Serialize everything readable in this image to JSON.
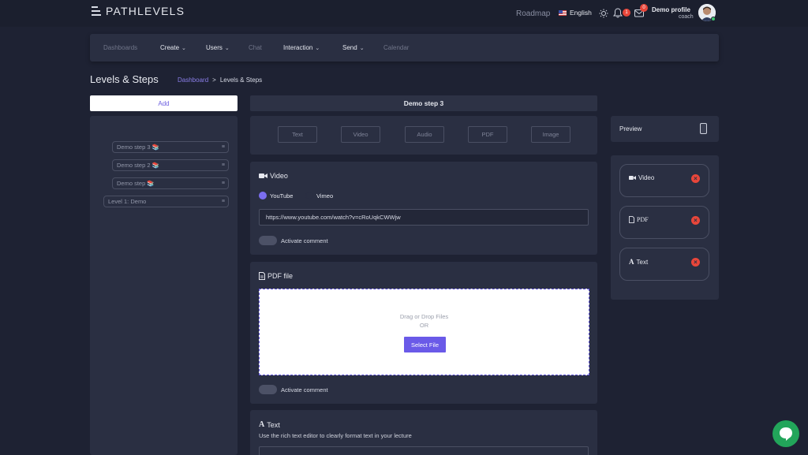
{
  "header": {
    "logo_text": "PATHLEVELS",
    "roadmap_label": "Roadmap",
    "language": "English",
    "notifications_count": "1",
    "messages_count": "0",
    "profile_name": "Demo profile",
    "profile_role": "coach"
  },
  "nav": {
    "items": [
      {
        "label": "Dashboards",
        "dropdown": false,
        "enabled": false
      },
      {
        "label": "Create",
        "dropdown": true,
        "enabled": true
      },
      {
        "label": "Users",
        "dropdown": true,
        "enabled": true
      },
      {
        "label": "Chat",
        "dropdown": false,
        "enabled": false
      },
      {
        "label": "Interaction",
        "dropdown": true,
        "enabled": true
      },
      {
        "label": "Send",
        "dropdown": true,
        "enabled": true
      },
      {
        "label": "Calendar",
        "dropdown": false,
        "enabled": false
      }
    ]
  },
  "page": {
    "title": "Levels & Steps",
    "breadcrumb": {
      "link": "Dashboard",
      "separator": ">",
      "current": "Levels & Steps"
    }
  },
  "left": {
    "add_label": "Add",
    "tree": [
      {
        "label": "Demo step 3 📚"
      },
      {
        "label": "Demo step 2 📚"
      },
      {
        "label": "Demo step 📚"
      },
      {
        "label": "Level 1: Demo"
      }
    ]
  },
  "step": {
    "title": "Demo step 3",
    "types": [
      "Text",
      "Video",
      "Audio",
      "PDF",
      "Image"
    ]
  },
  "video_card": {
    "title": "Video",
    "options": [
      "YouTube",
      "Vimeo"
    ],
    "selected": "YouTube",
    "url": "https://www.youtube.com/watch?v=cRoUqkCWWjw",
    "comment_label": "Activate comment"
  },
  "pdf_card": {
    "title": "PDF file",
    "drag_text": "Drag or Drop Files",
    "or_text": "OR",
    "select_label": "Select File",
    "comment_label": "Activate comment"
  },
  "text_card": {
    "title": "Text",
    "subtitle": "Use the rich text editor to clearly format text in your lecture"
  },
  "preview": {
    "label": "Preview",
    "components": [
      {
        "label": "Video",
        "icon": "video-icon"
      },
      {
        "label": "PDF",
        "icon": "pdf-icon"
      },
      {
        "label": "Text",
        "icon": "text-icon"
      }
    ]
  },
  "colors": {
    "background": "#1e2233",
    "panel": "#2a2f42",
    "accent": "#6a5ae8",
    "danger": "#e8463a",
    "chat": "#22a55a"
  }
}
